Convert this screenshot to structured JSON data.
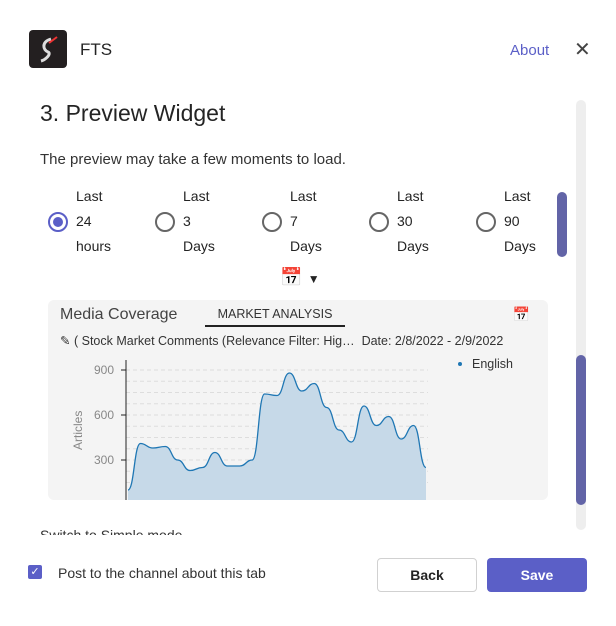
{
  "header": {
    "app_name": "FTS",
    "about": "About",
    "close_icon": "close-icon"
  },
  "page": {
    "title": "3. Preview Widget",
    "subtitle": "The preview may take a few moments to load.",
    "ranges": [
      {
        "label": "Last\n24\nhours",
        "selected": true
      },
      {
        "label": "Last\n3\nDays",
        "selected": false
      },
      {
        "label": "Last\n7\nDays",
        "selected": false
      },
      {
        "label": "Last\n30\nDays",
        "selected": false
      },
      {
        "label": "Last\n90\nDays",
        "selected": false
      }
    ],
    "switch_link": "Switch to Simple mode"
  },
  "widget": {
    "title": "Media Coverage",
    "tab": "MARKET ANALYSIS",
    "filter": "( Stock Market Comments (Relevance Filter: Hig…",
    "date": "Date: 2/8/2022 - 2/9/2022"
  },
  "chart_data": {
    "type": "area",
    "ylabel": "Articles",
    "yticks": [
      "900",
      "600",
      "300"
    ],
    "ylim": [
      90,
      960
    ],
    "legend": "English",
    "legend_position": "top-right",
    "grid": true,
    "color": "#1f77b4",
    "series": [
      {
        "name": "English",
        "values": [
          100,
          410,
          380,
          390,
          300,
          230,
          250,
          350,
          260,
          260,
          300,
          740,
          730,
          880,
          760,
          810,
          650,
          500,
          420,
          660,
          530,
          590,
          440,
          530,
          250
        ]
      }
    ]
  },
  "footer": {
    "checkbox_label": "Post to the channel about this tab",
    "checked": true,
    "back": "Back",
    "save": "Save"
  },
  "colors": {
    "accent": "#5b5fc7"
  }
}
